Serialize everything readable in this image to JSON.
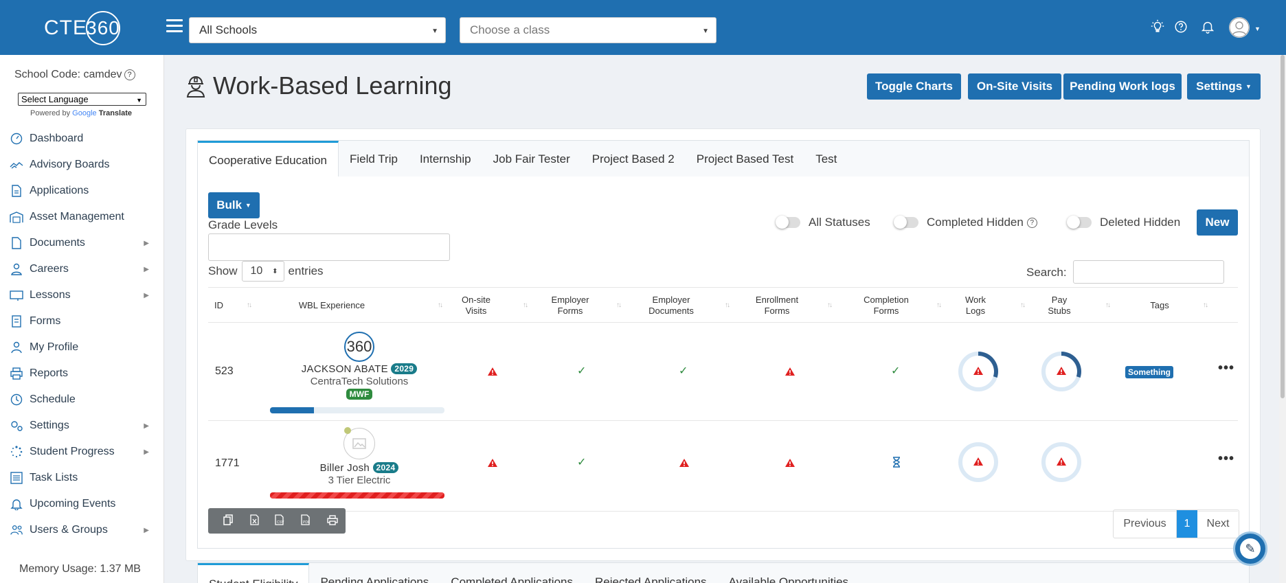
{
  "topbar": {
    "logo_text": "CTE",
    "logo_ring": "360",
    "school_select": "All Schools",
    "class_placeholder": "Choose a class",
    "icons": [
      "lightbulb-icon",
      "help-icon",
      "bell-icon",
      "user-avatar-icon"
    ]
  },
  "sidebar": {
    "school_code": "School Code: camdev",
    "language_select": "Select Language",
    "powered_by": "Powered by",
    "google": "Google",
    "translate": "Translate",
    "items": [
      {
        "label": "Dashboard",
        "icon": "gauge-icon",
        "has_arrow": false
      },
      {
        "label": "Advisory Boards",
        "icon": "handshake-icon",
        "has_arrow": false
      },
      {
        "label": "Applications",
        "icon": "document-icon",
        "has_arrow": false
      },
      {
        "label": "Asset Management",
        "icon": "warehouse-icon",
        "has_arrow": false
      },
      {
        "label": "Documents",
        "icon": "file-icon",
        "has_arrow": true
      },
      {
        "label": "Careers",
        "icon": "user-tie-icon",
        "has_arrow": true
      },
      {
        "label": "Lessons",
        "icon": "chalkboard-icon",
        "has_arrow": true
      },
      {
        "label": "Forms",
        "icon": "form-icon",
        "has_arrow": false
      },
      {
        "label": "My Profile",
        "icon": "user-icon",
        "has_arrow": false
      },
      {
        "label": "Reports",
        "icon": "print-icon",
        "has_arrow": false
      },
      {
        "label": "Schedule",
        "icon": "clock-icon",
        "has_arrow": false
      },
      {
        "label": "Settings",
        "icon": "cogs-icon",
        "has_arrow": true
      },
      {
        "label": "Student Progress",
        "icon": "spinner-icon",
        "has_arrow": true
      },
      {
        "label": "Task Lists",
        "icon": "list-icon",
        "has_arrow": false
      },
      {
        "label": "Upcoming Events",
        "icon": "bell-icon",
        "has_arrow": false
      },
      {
        "label": "Users & Groups",
        "icon": "users-icon",
        "has_arrow": true
      }
    ],
    "memory": "Memory Usage: 1.37 MB"
  },
  "page": {
    "title": "Work-Based Learning",
    "buttons": {
      "toggle_charts": "Toggle Charts",
      "onsite_visits": "On-Site Visits",
      "pending_logs": "Pending Work logs",
      "settings": "Settings"
    }
  },
  "tabs": [
    "Cooperative Education",
    "Field Trip",
    "Internship",
    "Job Fair Tester",
    "Project Based 2",
    "Project Based Test",
    "Test"
  ],
  "controls": {
    "bulk": "Bulk",
    "grade_levels": "Grade Levels",
    "toggles": [
      "All Statuses",
      "Completed Hidden",
      "Deleted Hidden"
    ],
    "new": "New",
    "show": "Show",
    "entries_value": "10",
    "entries": "entries",
    "search": "Search:"
  },
  "table": {
    "headers": [
      "ID",
      "WBL Experience",
      "On-site Visits",
      "Employer Forms",
      "Employer Documents",
      "Enrollment Forms",
      "Completion Forms",
      "Work Logs",
      "Pay Stubs",
      "Tags"
    ],
    "rows": [
      {
        "id": "523",
        "name": "JACKSON ABATE",
        "year": "2029",
        "company": "CentraTech Solutions",
        "schedule": "MWF",
        "progress": 0.25,
        "onsite": "warning",
        "employer_forms": "check",
        "employer_documents": "check",
        "enrollment_forms": "warning",
        "completion_forms": "check",
        "work_logs_fraction": 0.3,
        "pay_stubs_fraction": 0.3,
        "tag": "Something"
      },
      {
        "id": "1771",
        "name": "Biller Josh",
        "year": "2024",
        "company": "3 Tier Electric",
        "schedule": "",
        "progress": 1.0,
        "onsite": "warning",
        "employer_forms": "check",
        "employer_documents": "warning",
        "enrollment_forms": "warning",
        "completion_forms": "hourglass",
        "work_logs_fraction": 0,
        "pay_stubs_fraction": 0,
        "tag": ""
      }
    ]
  },
  "export_icons": [
    "copy-icon",
    "excel-icon",
    "csv-icon",
    "pdf-icon",
    "print-icon"
  ],
  "pagination": {
    "previous": "Previous",
    "current": "1",
    "next": "Next"
  },
  "bottom_tabs": [
    "Student Eligibility",
    "Pending Applications",
    "Completed Applications",
    "Rejected Applications",
    "Available Opportunities"
  ],
  "colors": {
    "primary": "#1f6fb0",
    "warning": "#e02020",
    "success": "#2e8b3e",
    "badge_teal": "#1a7c8a"
  }
}
